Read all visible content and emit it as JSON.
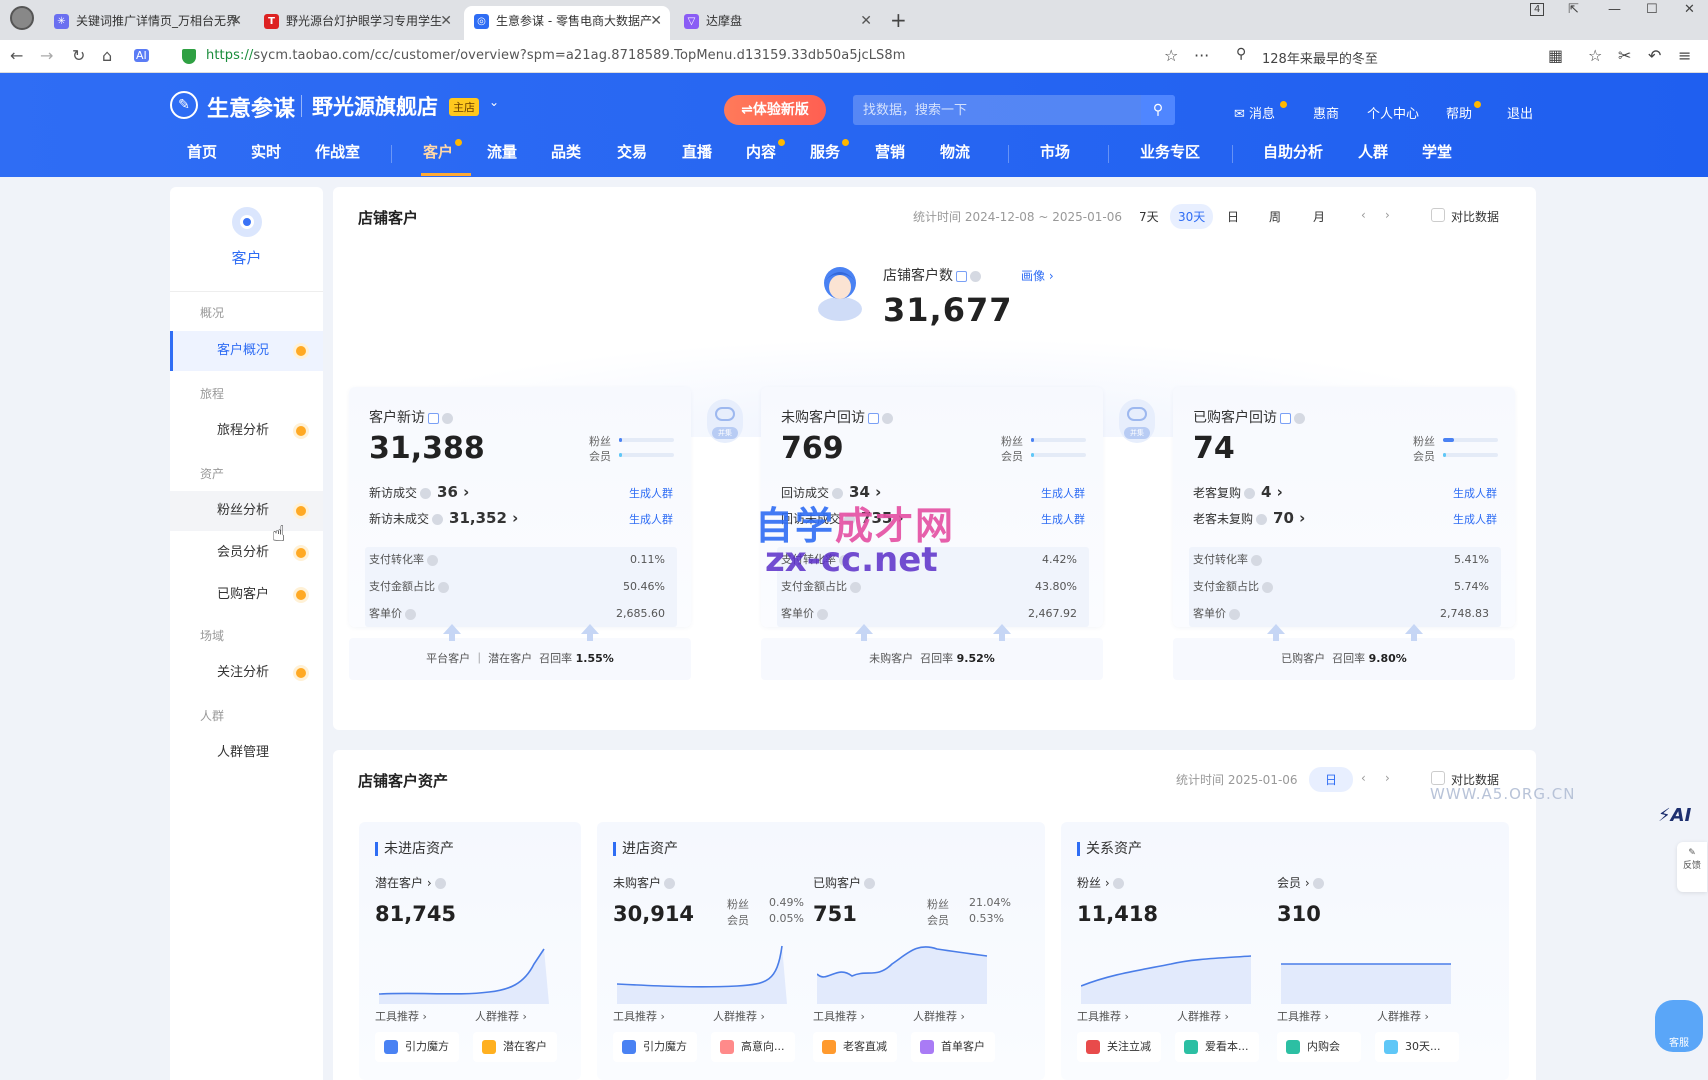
{
  "browser": {
    "tabs": [
      {
        "title": "关键词推广详情页_万相台无界",
        "active": false
      },
      {
        "title": "野光源台灯护眼学习专用学生",
        "active": false
      },
      {
        "title": "生意参谋 - 零售电商大数据产",
        "active": true
      },
      {
        "title": "达摩盘",
        "active": false
      }
    ],
    "new_tab": "+",
    "url_scheme": "https://",
    "url_rest": "sycm.taobao.com/cc/customer/overview?spm=a21ag.8718589.TopMenu.d13159.33db50a5jcLS8m",
    "search_text": "128年来最早的冬至",
    "tab_count": "4"
  },
  "header": {
    "brand": "生意参谋",
    "store": "野光源旗舰店",
    "store_badge": "主店",
    "try_new": "⇌体验新版",
    "search_placeholder": "找数据，搜索一下",
    "links": [
      "消息",
      "惠商",
      "个人中心",
      "帮助",
      "退出"
    ],
    "nav": [
      "首页",
      "实时",
      "作战室",
      "客户",
      "流量",
      "品类",
      "交易",
      "直播",
      "内容",
      "服务",
      "营销",
      "物流",
      "市场",
      "业务专区",
      "自助分析",
      "人群",
      "学堂"
    ]
  },
  "sidebar": {
    "title": "客户",
    "groups": [
      {
        "label": "概况",
        "items": [
          {
            "label": "客户概况",
            "state": "active"
          }
        ]
      },
      {
        "label": "旅程",
        "items": [
          {
            "label": "旅程分析"
          }
        ]
      },
      {
        "label": "资产",
        "items": [
          {
            "label": "粉丝分析",
            "state": "hover"
          },
          {
            "label": "会员分析"
          },
          {
            "label": "已购客户"
          }
        ]
      },
      {
        "label": "场域",
        "items": [
          {
            "label": "关注分析"
          }
        ]
      },
      {
        "label": "人群",
        "items": [
          {
            "label": "人群管理"
          }
        ]
      }
    ]
  },
  "overview": {
    "title": "店铺客户",
    "stat_time": "统计时间 2024-12-08 ~ 2025-01-06",
    "ranges": [
      "7天",
      "30天",
      "日",
      "周",
      "月"
    ],
    "active_range": "30天",
    "compare_label": "对比数据",
    "total_label": "店铺客户数",
    "total_value": "31,677",
    "profile_link": "画像 ›",
    "connector_label": "并集",
    "panels": [
      {
        "title": "客户新访",
        "value": "31,388",
        "mini": [
          "粉丝",
          "会员"
        ],
        "mini_fill": [
          0.05,
          0.05
        ],
        "rows": [
          {
            "label": "新访成交",
            "value": "36 ›",
            "link": "生成人群"
          },
          {
            "label": "新访未成交",
            "value": "31,352 ›",
            "link": "生成人群"
          }
        ],
        "metrics": [
          {
            "label": "支付转化率",
            "value": "0.11%"
          },
          {
            "label": "支付金额占比",
            "value": "50.46%"
          },
          {
            "label": "客单价",
            "value": "2,685.60"
          }
        ],
        "footer_a": "平台客户 ｜ 潜在客户",
        "footer_b": "召回率",
        "footer_v": "1.55%"
      },
      {
        "title": "未购客户回访",
        "value": "769",
        "mini": [
          "粉丝",
          "会员"
        ],
        "mini_fill": [
          0.06,
          0.04
        ],
        "rows": [
          {
            "label": "回访成交",
            "value": "34 ›",
            "link": "生成人群"
          },
          {
            "label": "回访未成交",
            "value": "735 ›",
            "link": "生成人群"
          }
        ],
        "metrics": [
          {
            "label": "支付转化率",
            "value": "4.42%"
          },
          {
            "label": "支付金额占比",
            "value": "43.80%"
          },
          {
            "label": "客单价",
            "value": "2,467.92"
          }
        ],
        "footer_a": "未购客户",
        "footer_b": "召回率",
        "footer_v": "9.52%"
      },
      {
        "title": "已购客户回访",
        "value": "74",
        "mini": [
          "粉丝",
          "会员"
        ],
        "mini_fill": [
          0.2,
          0.04
        ],
        "rows": [
          {
            "label": "老客复购",
            "value": "4 ›",
            "link": "生成人群"
          },
          {
            "label": "老客未复购",
            "value": "70 ›",
            "link": "生成人群"
          }
        ],
        "metrics": [
          {
            "label": "支付转化率",
            "value": "5.41%"
          },
          {
            "label": "支付金额占比",
            "value": "5.74%"
          },
          {
            "label": "客单价",
            "value": "2,748.83"
          }
        ],
        "footer_a": "已购客户",
        "footer_b": "召回率",
        "footer_v": "9.80%"
      }
    ]
  },
  "watermarks": {
    "line1a": "自学",
    "line1b": "成才网",
    "line2": "zx-cc.net",
    "site": "WWW.A5.ORG.CN"
  },
  "assets": {
    "title": "店铺客户资产",
    "stat_time": "统计时间 2025-01-06",
    "range": "日",
    "compare_label": "对比数据",
    "groups": [
      {
        "title": "未进店资产"
      },
      {
        "title": "进店资产"
      },
      {
        "title": "关系资产"
      }
    ],
    "cols": [
      {
        "label": "潜在客户 ›",
        "value": "81,745",
        "tool": "工具推荐 ›",
        "crowd": "人群推荐 ›",
        "btns": [
          "引力魔方",
          "潜在客户"
        ]
      },
      {
        "label": "未购客户",
        "value": "30,914",
        "mini": [
          [
            "粉丝",
            "0.49%"
          ],
          [
            "会员",
            "0.05%"
          ]
        ],
        "tool": "工具推荐 ›",
        "crowd": "人群推荐 ›",
        "btns": [
          "引力魔方",
          "高意向..."
        ]
      },
      {
        "label": "已购客户",
        "value": "751",
        "mini": [
          [
            "粉丝",
            "21.04%"
          ],
          [
            "会员",
            "0.53%"
          ]
        ],
        "tool": "工具推荐 ›",
        "crowd": "人群推荐 ›",
        "btns": [
          "老客直减",
          "首单客户"
        ]
      },
      {
        "label": "粉丝 ›",
        "value": "11,418",
        "tool": "工具推荐 ›",
        "crowd": "人群推荐 ›",
        "btns": [
          "关注立减",
          "爱看本..."
        ]
      },
      {
        "label": "会员 ›",
        "value": "310",
        "tool": "工具推荐 ›",
        "crowd": "人群推荐 ›",
        "btns": [
          "内购会",
          "30天..."
        ]
      }
    ]
  },
  "floating": {
    "ai": "AI",
    "feedback": "反馈",
    "service": "客服"
  },
  "colors": {
    "primary": "#2f6df4",
    "orange_dot": "#ffa924",
    "header_bg": "#2f6df4"
  }
}
